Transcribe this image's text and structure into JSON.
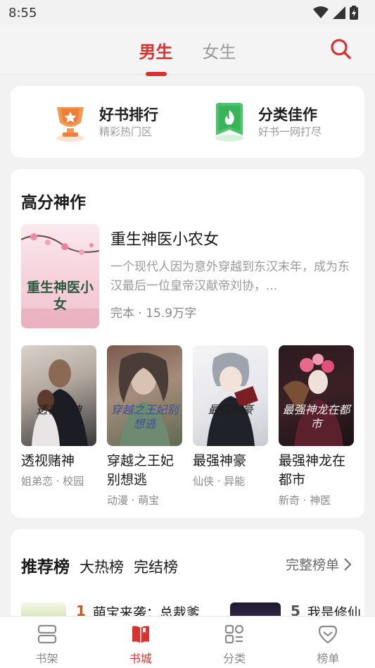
{
  "status_bar": {
    "time": "8:55"
  },
  "header": {
    "tabs": [
      {
        "label": "男生",
        "active": true
      },
      {
        "label": "女生",
        "active": false
      }
    ]
  },
  "quick_links": [
    {
      "title": "好书排行",
      "subtitle": "精彩热门区",
      "icon": "trophy-icon"
    },
    {
      "title": "分类佳作",
      "subtitle": "好书一网打尽",
      "icon": "flame-bookmark-icon"
    }
  ],
  "featured": {
    "section_title": "高分神作",
    "main_book": {
      "cover_text": "重生神医小女",
      "title": "重生神医小农女",
      "description": "一个现代人因为意外穿越到东汉末年，成为东汉最后一位皇帝汉献帝刘协，...",
      "meta": "完本 · 15.9万字"
    },
    "books": [
      {
        "cover_text": "透视赌神",
        "title": "透视赌神",
        "tags": "姐弟恋 · 校园"
      },
      {
        "cover_text": "穿越之王妃别想逃",
        "title": "穿越之王妃别想逃",
        "tags": "动漫 · 萌宝"
      },
      {
        "cover_text": "最强神豪",
        "title": "最强神豪",
        "tags": "仙侠 · 异能"
      },
      {
        "cover_text": "最强神龙在都市",
        "title": "最强神龙在都市",
        "tags": "新奇 · 神医"
      }
    ]
  },
  "ranking": {
    "tabs": [
      {
        "label": "推荐榜",
        "active": true
      },
      {
        "label": "大热榜",
        "active": false
      },
      {
        "label": "完结榜",
        "active": false
      }
    ],
    "more_label": "完整榜单",
    "rows": [
      {
        "rank": "1",
        "title": "萌宝来袭：总裁爹"
      },
      {
        "rank": "5",
        "title": "我是修仙"
      }
    ]
  },
  "bottom_nav": [
    {
      "label": "书架",
      "icon": "bookshelf-icon",
      "active": false
    },
    {
      "label": "书城",
      "icon": "book-store-icon",
      "active": true
    },
    {
      "label": "分类",
      "icon": "category-icon",
      "active": false
    },
    {
      "label": "榜单",
      "icon": "ranking-icon",
      "active": false
    }
  ],
  "colors": {
    "accent": "#d8332f",
    "background": "#f2f2f2",
    "card": "#ffffff",
    "rank_number": "#c75a1c"
  }
}
